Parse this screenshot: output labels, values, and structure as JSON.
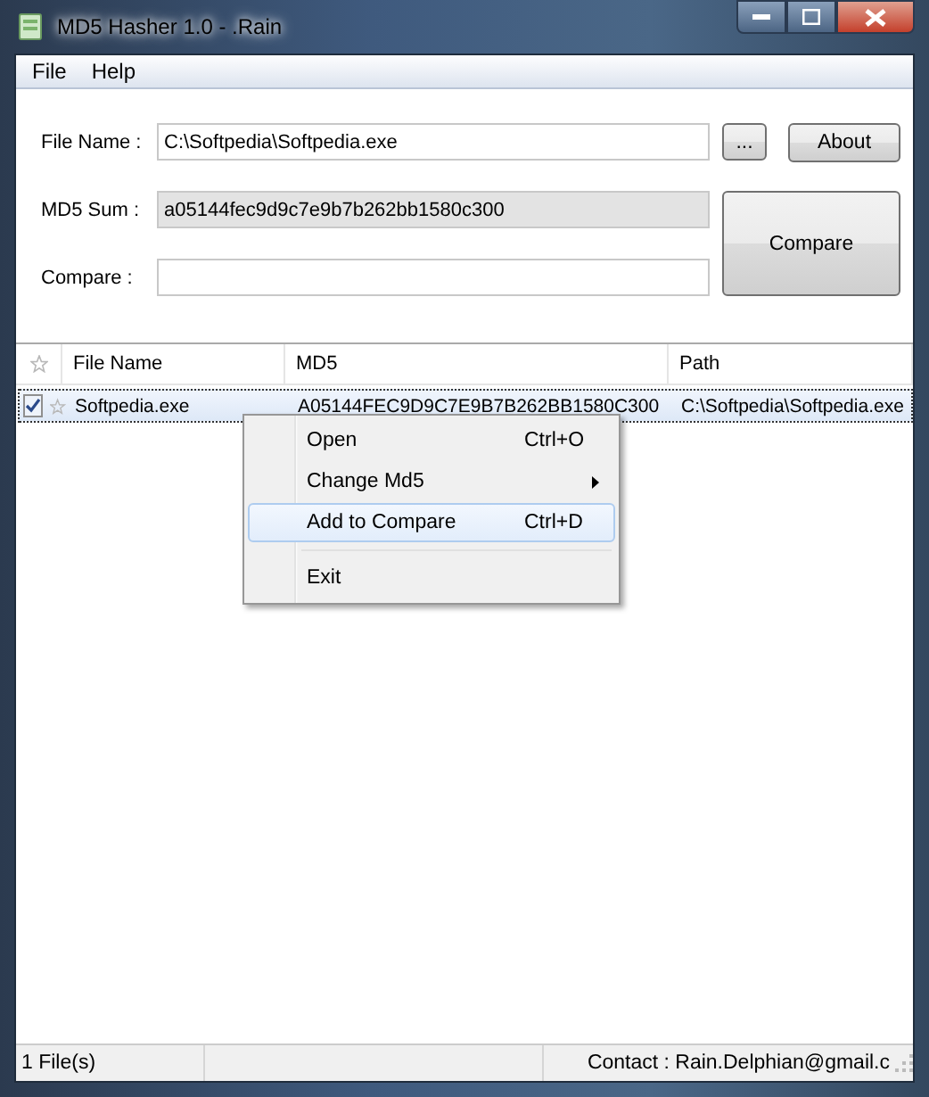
{
  "window": {
    "title": "MD5 Hasher 1.0 - .Rain"
  },
  "menu_bar": [
    "File",
    "Help"
  ],
  "form": {
    "file_name": {
      "label": "File Name :",
      "value": "C:\\Softpedia\\Softpedia.exe"
    },
    "md5_sum": {
      "label": "MD5 Sum  :",
      "value": "a05144fec9d9c7e9b7b262bb1580c300"
    },
    "compare": {
      "label": "Compare  :"
    },
    "browse_button": "...",
    "about_button": "About",
    "compare_button": "Compare"
  },
  "table": {
    "columns": [
      "File Name",
      "MD5",
      "Path"
    ],
    "rows": [
      {
        "checked": true,
        "selected": true,
        "file_name": "Softpedia.exe",
        "md5": "A05144FEC9D9C7E9B7B262BB1580C300",
        "path": "C:\\Softpedia\\Softpedia.exe"
      }
    ]
  },
  "context_menu": [
    {
      "kind": "item",
      "label": "Open",
      "shortcut": "Ctrl+O",
      "submenu": false,
      "selected": false
    },
    {
      "kind": "item",
      "label": "Change Md5",
      "submenu": true,
      "selected": false
    },
    {
      "kind": "item",
      "label": "Add to Compare",
      "shortcut": "Ctrl+D",
      "submenu": false,
      "selected": true
    },
    {
      "kind": "separator"
    },
    {
      "kind": "item",
      "label": "Exit",
      "submenu": false,
      "selected": false
    }
  ],
  "status_bar": {
    "files": "1 File(s)",
    "contact": "Contact : Rain.Delphian@gmail.c"
  }
}
